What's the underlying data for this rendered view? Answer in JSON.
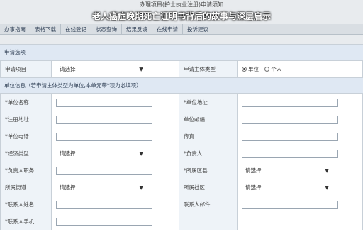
{
  "window_title": "办理项目(护士执业注册)申请须知",
  "overlay_caption": "老人癌症晚期死亡证明书背后的故事与深层启示",
  "tabs": [
    "办事指南",
    "表格下载",
    "在线登记",
    "状态查询",
    "结果反馈",
    "在线申请",
    "投诉建议"
  ],
  "apply_section": {
    "header": "申请选项",
    "row": {
      "label_project": "申请项目",
      "project_select": "请选择",
      "label_subject": "申请主体类型",
      "options": [
        "单位",
        "个人"
      ],
      "selected": "单位"
    }
  },
  "unit_section": {
    "header": "单位信息（若申请主体类型为单位,本单元带*项为必填项）",
    "rows": [
      {
        "left_label": "*单位名称",
        "left_type": "input",
        "left_value": "",
        "right_label": "*单位地址",
        "right_type": "input",
        "right_value": ""
      },
      {
        "left_label": "*注册地址",
        "left_type": "input",
        "left_value": "",
        "right_label": "单位邮编",
        "right_type": "input",
        "right_value": ""
      },
      {
        "left_label": "*单位电话",
        "left_type": "input",
        "left_value": "",
        "right_label": "传真",
        "right_type": "input",
        "right_value": ""
      },
      {
        "left_label": "*经济类型",
        "left_type": "select",
        "left_value": "请选择",
        "right_label": "*负责人",
        "right_type": "input",
        "right_value": ""
      },
      {
        "left_label": "*负责人职务",
        "left_type": "input",
        "left_value": "",
        "right_label": "*所属区县",
        "right_type": "select",
        "right_value": "请选择"
      },
      {
        "left_label": "所属街道",
        "left_type": "select",
        "left_value": "请选择",
        "right_label": "所属社区",
        "right_type": "select",
        "right_value": "请选择"
      },
      {
        "left_label": "*联系人姓名",
        "left_type": "input",
        "left_value": "",
        "right_label": "联系人邮件",
        "right_type": "input",
        "right_value": ""
      },
      {
        "left_label": "*联系人手机",
        "left_type": "input",
        "left_value": "",
        "right_label": "",
        "right_type": "none",
        "right_value": ""
      }
    ]
  },
  "colors": {
    "header_bg": "#dfe8f3",
    "label_bg": "#eef3f8",
    "border": "#c8d0d8"
  }
}
